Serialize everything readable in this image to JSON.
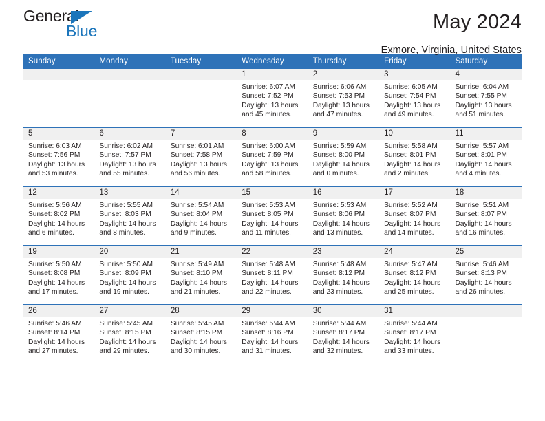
{
  "brand": {
    "name_part1": "General",
    "name_part2": "Blue",
    "triangle_icon": "triangle-icon",
    "color_dark": "#231f20",
    "color_blue": "#1b75bb"
  },
  "header": {
    "title": "May 2024",
    "subtitle": "Exmore, Virginia, United States"
  },
  "theme": {
    "header_blue": "#2e72b8",
    "band_gray": "#f0f0f0",
    "text": "#231f20"
  },
  "calendar": {
    "weekday_headers": [
      "Sunday",
      "Monday",
      "Tuesday",
      "Wednesday",
      "Thursday",
      "Friday",
      "Saturday"
    ],
    "weeks": [
      [
        {
          "day": "",
          "empty": true
        },
        {
          "day": "",
          "empty": true
        },
        {
          "day": "",
          "empty": true
        },
        {
          "day": "1",
          "sunrise": "Sunrise: 6:07 AM",
          "sunset": "Sunset: 7:52 PM",
          "daylight": "Daylight: 13 hours and 45 minutes."
        },
        {
          "day": "2",
          "sunrise": "Sunrise: 6:06 AM",
          "sunset": "Sunset: 7:53 PM",
          "daylight": "Daylight: 13 hours and 47 minutes."
        },
        {
          "day": "3",
          "sunrise": "Sunrise: 6:05 AM",
          "sunset": "Sunset: 7:54 PM",
          "daylight": "Daylight: 13 hours and 49 minutes."
        },
        {
          "day": "4",
          "sunrise": "Sunrise: 6:04 AM",
          "sunset": "Sunset: 7:55 PM",
          "daylight": "Daylight: 13 hours and 51 minutes."
        }
      ],
      [
        {
          "day": "5",
          "sunrise": "Sunrise: 6:03 AM",
          "sunset": "Sunset: 7:56 PM",
          "daylight": "Daylight: 13 hours and 53 minutes."
        },
        {
          "day": "6",
          "sunrise": "Sunrise: 6:02 AM",
          "sunset": "Sunset: 7:57 PM",
          "daylight": "Daylight: 13 hours and 55 minutes."
        },
        {
          "day": "7",
          "sunrise": "Sunrise: 6:01 AM",
          "sunset": "Sunset: 7:58 PM",
          "daylight": "Daylight: 13 hours and 56 minutes."
        },
        {
          "day": "8",
          "sunrise": "Sunrise: 6:00 AM",
          "sunset": "Sunset: 7:59 PM",
          "daylight": "Daylight: 13 hours and 58 minutes."
        },
        {
          "day": "9",
          "sunrise": "Sunrise: 5:59 AM",
          "sunset": "Sunset: 8:00 PM",
          "daylight": "Daylight: 14 hours and 0 minutes."
        },
        {
          "day": "10",
          "sunrise": "Sunrise: 5:58 AM",
          "sunset": "Sunset: 8:01 PM",
          "daylight": "Daylight: 14 hours and 2 minutes."
        },
        {
          "day": "11",
          "sunrise": "Sunrise: 5:57 AM",
          "sunset": "Sunset: 8:01 PM",
          "daylight": "Daylight: 14 hours and 4 minutes."
        }
      ],
      [
        {
          "day": "12",
          "sunrise": "Sunrise: 5:56 AM",
          "sunset": "Sunset: 8:02 PM",
          "daylight": "Daylight: 14 hours and 6 minutes."
        },
        {
          "day": "13",
          "sunrise": "Sunrise: 5:55 AM",
          "sunset": "Sunset: 8:03 PM",
          "daylight": "Daylight: 14 hours and 8 minutes."
        },
        {
          "day": "14",
          "sunrise": "Sunrise: 5:54 AM",
          "sunset": "Sunset: 8:04 PM",
          "daylight": "Daylight: 14 hours and 9 minutes."
        },
        {
          "day": "15",
          "sunrise": "Sunrise: 5:53 AM",
          "sunset": "Sunset: 8:05 PM",
          "daylight": "Daylight: 14 hours and 11 minutes."
        },
        {
          "day": "16",
          "sunrise": "Sunrise: 5:53 AM",
          "sunset": "Sunset: 8:06 PM",
          "daylight": "Daylight: 14 hours and 13 minutes."
        },
        {
          "day": "17",
          "sunrise": "Sunrise: 5:52 AM",
          "sunset": "Sunset: 8:07 PM",
          "daylight": "Daylight: 14 hours and 14 minutes."
        },
        {
          "day": "18",
          "sunrise": "Sunrise: 5:51 AM",
          "sunset": "Sunset: 8:07 PM",
          "daylight": "Daylight: 14 hours and 16 minutes."
        }
      ],
      [
        {
          "day": "19",
          "sunrise": "Sunrise: 5:50 AM",
          "sunset": "Sunset: 8:08 PM",
          "daylight": "Daylight: 14 hours and 17 minutes."
        },
        {
          "day": "20",
          "sunrise": "Sunrise: 5:50 AM",
          "sunset": "Sunset: 8:09 PM",
          "daylight": "Daylight: 14 hours and 19 minutes."
        },
        {
          "day": "21",
          "sunrise": "Sunrise: 5:49 AM",
          "sunset": "Sunset: 8:10 PM",
          "daylight": "Daylight: 14 hours and 21 minutes."
        },
        {
          "day": "22",
          "sunrise": "Sunrise: 5:48 AM",
          "sunset": "Sunset: 8:11 PM",
          "daylight": "Daylight: 14 hours and 22 minutes."
        },
        {
          "day": "23",
          "sunrise": "Sunrise: 5:48 AM",
          "sunset": "Sunset: 8:12 PM",
          "daylight": "Daylight: 14 hours and 23 minutes."
        },
        {
          "day": "24",
          "sunrise": "Sunrise: 5:47 AM",
          "sunset": "Sunset: 8:12 PM",
          "daylight": "Daylight: 14 hours and 25 minutes."
        },
        {
          "day": "25",
          "sunrise": "Sunrise: 5:46 AM",
          "sunset": "Sunset: 8:13 PM",
          "daylight": "Daylight: 14 hours and 26 minutes."
        }
      ],
      [
        {
          "day": "26",
          "sunrise": "Sunrise: 5:46 AM",
          "sunset": "Sunset: 8:14 PM",
          "daylight": "Daylight: 14 hours and 27 minutes."
        },
        {
          "day": "27",
          "sunrise": "Sunrise: 5:45 AM",
          "sunset": "Sunset: 8:15 PM",
          "daylight": "Daylight: 14 hours and 29 minutes."
        },
        {
          "day": "28",
          "sunrise": "Sunrise: 5:45 AM",
          "sunset": "Sunset: 8:15 PM",
          "daylight": "Daylight: 14 hours and 30 minutes."
        },
        {
          "day": "29",
          "sunrise": "Sunrise: 5:44 AM",
          "sunset": "Sunset: 8:16 PM",
          "daylight": "Daylight: 14 hours and 31 minutes."
        },
        {
          "day": "30",
          "sunrise": "Sunrise: 5:44 AM",
          "sunset": "Sunset: 8:17 PM",
          "daylight": "Daylight: 14 hours and 32 minutes."
        },
        {
          "day": "31",
          "sunrise": "Sunrise: 5:44 AM",
          "sunset": "Sunset: 8:17 PM",
          "daylight": "Daylight: 14 hours and 33 minutes."
        },
        {
          "day": "",
          "empty": true
        }
      ]
    ]
  }
}
